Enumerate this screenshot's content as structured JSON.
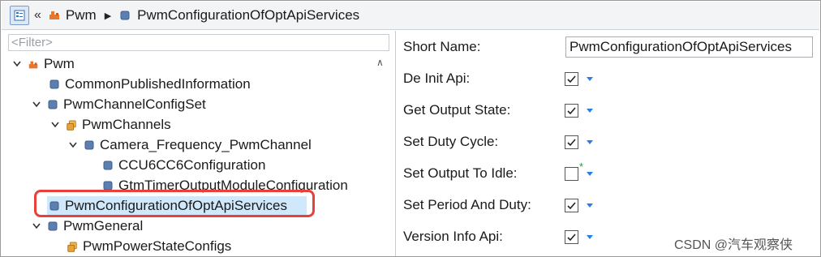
{
  "breadcrumb": {
    "back_glyph": "«",
    "module": "Pwm",
    "separator": "▶",
    "container": "PwmConfigurationOfOptApiServices"
  },
  "tree": {
    "filter_placeholder": "<Filter>",
    "items": [
      {
        "label": "Pwm",
        "expanded": true,
        "icon": "module-icon"
      },
      {
        "label": "CommonPublishedInformation",
        "icon": "container-icon"
      },
      {
        "label": "PwmChannelConfigSet",
        "expanded": true,
        "icon": "container-icon"
      },
      {
        "label": "PwmChannels",
        "expanded": true,
        "icon": "list-icon"
      },
      {
        "label": "Camera_Frequency_PwmChannel",
        "expanded": true,
        "icon": "container-icon"
      },
      {
        "label": "CCU6CC6Configuration",
        "icon": "container-icon"
      },
      {
        "label": "GtmTimerOutputModuleConfiguration",
        "icon": "container-icon"
      },
      {
        "label": "PwmConfigurationOfOptApiServices",
        "selected": true,
        "icon": "container-icon"
      },
      {
        "label": "PwmGeneral",
        "expanded": true,
        "icon": "container-icon"
      },
      {
        "label": "PwmPowerStateConfigs",
        "icon": "list-icon"
      }
    ]
  },
  "properties": {
    "short_name": {
      "label": "Short Name:",
      "value": "PwmConfigurationOfOptApiServices"
    },
    "rows": [
      {
        "label": "De Init Api:",
        "checked": true
      },
      {
        "label": "Get Output State:",
        "checked": true
      },
      {
        "label": "Set Duty Cycle:",
        "checked": true
      },
      {
        "label": "Set Output To Idle:",
        "checked": false,
        "modified_marker": "*"
      },
      {
        "label": "Set Period And Duty:",
        "checked": true
      },
      {
        "label": "Version Info Api:",
        "checked": true
      }
    ]
  },
  "watermark": "CSDN @汽车观察侠",
  "colors": {
    "selection": "#cfe8fb",
    "highlight_border": "#e8413a",
    "dropdown_caret": "#2a7de1",
    "modified_star": "#22a033"
  }
}
